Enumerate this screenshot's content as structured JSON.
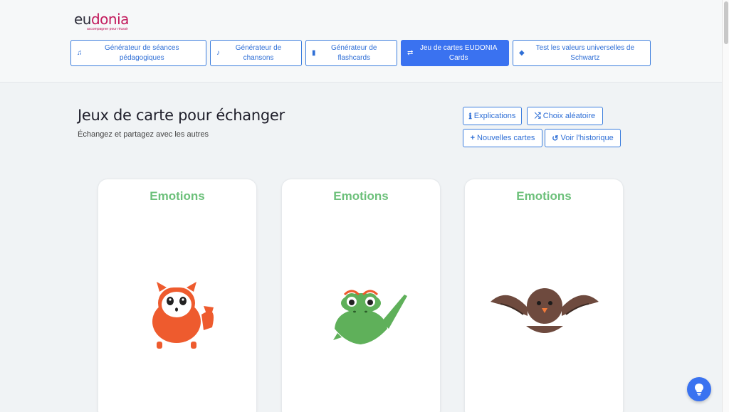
{
  "brand": {
    "logo_eu": "eu",
    "logo_donia": "donia",
    "tagline": "accompagner pour réussir",
    "brand_color": "#c2185b"
  },
  "nav": {
    "items": [
      {
        "label": "Générateur de séances pédagogiques",
        "icon": "music-note-icon",
        "active": false
      },
      {
        "label": "Générateur de chansons",
        "icon": "music-icon",
        "active": false
      },
      {
        "label": "Générateur de flashcards",
        "icon": "card-icon",
        "active": false
      },
      {
        "label": "Jeu de cartes EUDONIA Cards",
        "icon": "shuffle-people-icon",
        "active": true
      },
      {
        "label": "Test les valeurs universelles de Schwartz",
        "icon": "cube-icon",
        "active": false
      }
    ]
  },
  "page": {
    "title": "Jeux de carte pour échanger",
    "subtitle": "Échangez et partagez avec les autres"
  },
  "actions": {
    "explications": "Explications",
    "random": "Choix aléatoire",
    "new_cards": "Nouvelles cartes",
    "history": "Voir l'historique"
  },
  "cards": [
    {
      "title": "Emotions",
      "creature": "orange-cat-creature"
    },
    {
      "title": "Emotions",
      "creature": "green-frog-creature"
    },
    {
      "title": "Emotions",
      "creature": "brown-bird-creature"
    }
  ],
  "colors": {
    "accent": "#3a72f0",
    "card_title": "#6cc07a",
    "orange": "#ee5b2e",
    "green": "#5fb05a",
    "brown": "#6e4a3e"
  }
}
